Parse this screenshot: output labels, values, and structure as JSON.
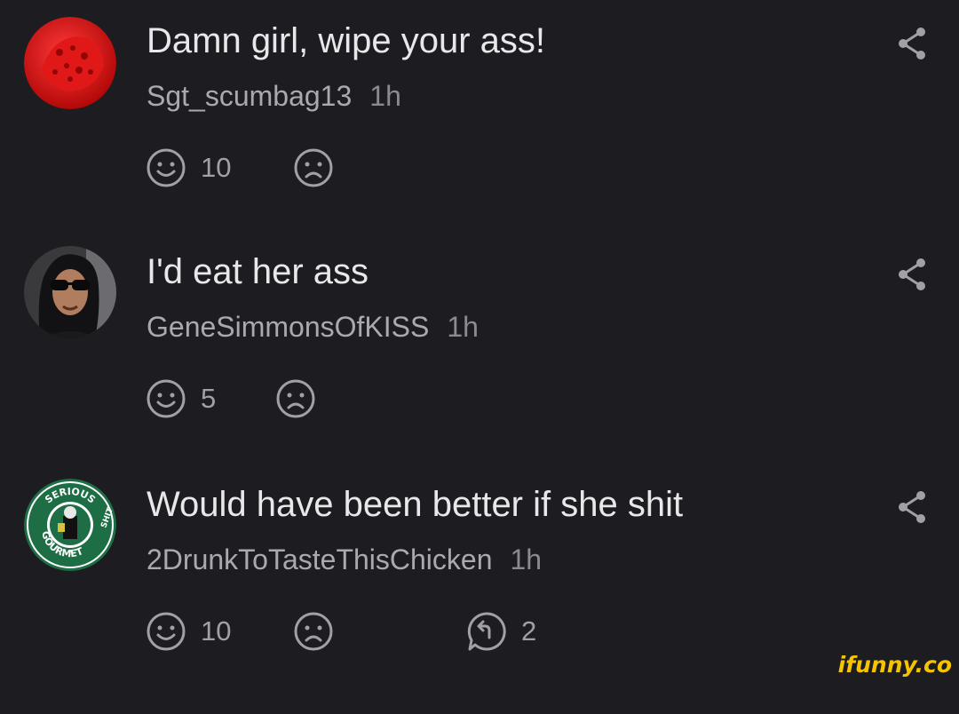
{
  "comments": [
    {
      "text": "Damn girl, wipe your ass!",
      "username": "Sgt_scumbag13",
      "time": "1h",
      "smile_count": "10",
      "avatar": "red-round-avatar"
    },
    {
      "text": "I'd eat her ass",
      "username": "GeneSimmonsOfKISS",
      "time": "1h",
      "smile_count": "5",
      "avatar": "man-with-sunglasses-avatar"
    },
    {
      "text": "Would have been better if she shit",
      "username": "2DrunkToTasteThisChicken",
      "time": "1h",
      "smile_count": "10",
      "reply_count": "2",
      "avatar": "serious-gourmet-shit-logo",
      "avatar_text": [
        "SERIOUS",
        "GOURMET",
        "SHIT"
      ]
    }
  ],
  "watermark": "ifunny.co",
  "colors": {
    "background": "#1c1c21",
    "text": "#e8e8ea",
    "meta": "#a9a9ae",
    "icon": "#a0a0a6",
    "watermark": "#f5c400"
  }
}
